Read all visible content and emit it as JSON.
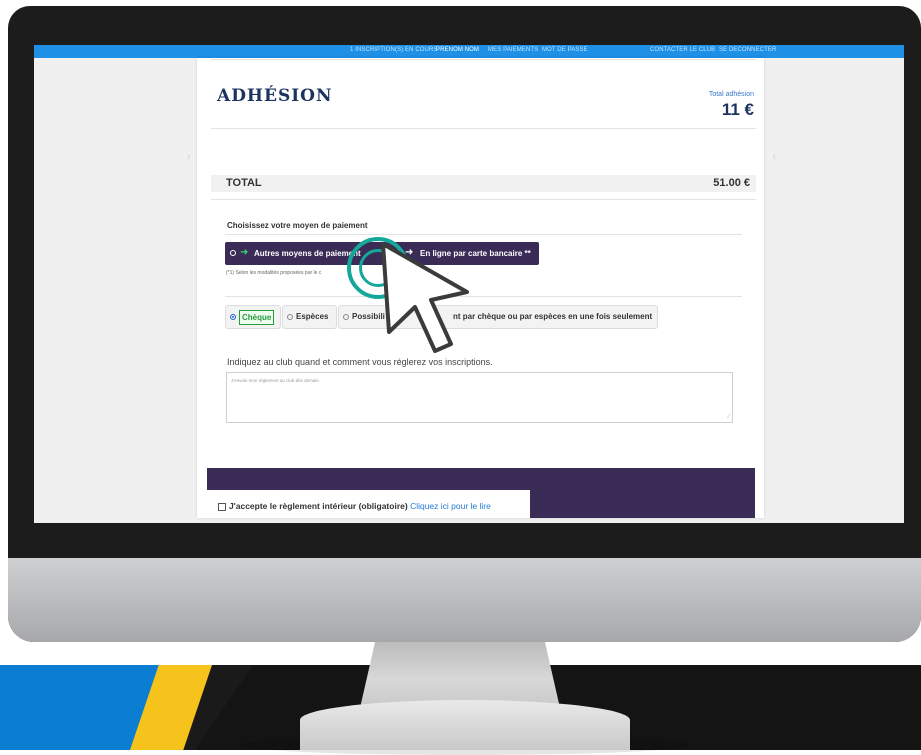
{
  "topbar": {
    "items": [
      "1 INSCRIPTION(S) EN COURS",
      "PRENOM NOM",
      "MES PAIEMENTS",
      "MOT DE PASSE",
      "CONTACTER LE CLUB",
      "SE DECONNECTER"
    ]
  },
  "header": {
    "title": "ADHÉSION",
    "total_label": "Total adhésion",
    "total_value": "11 €"
  },
  "total": {
    "label": "TOTAL",
    "value": "51.00 €"
  },
  "payment": {
    "prompt": "Choisissez votre moyen de paiement",
    "options": [
      "Autres moyens de paiement",
      "En ligne par carte bancaire **"
    ],
    "footnote": "(*1) Selon les modalités proposées par le c",
    "methods": [
      "Chèque",
      "Espèces",
      "Possibili",
      "nt par chèque ou par espèces en une fois seulement"
    ],
    "selected_method": "Chèque"
  },
  "comment": {
    "label": "Indiquez au club quand et comment vous réglerez vos inscriptions.",
    "value": "J'envoie mon règlement au club dès demain"
  },
  "acceptance": {
    "label": "J'accepte le règlement intérieur (obligatoire)",
    "link": "Cliquez ici pour le lire"
  },
  "colors": {
    "topbar": "#1e90e6",
    "navy": "#1d3461",
    "purple": "#3b2b57",
    "green": "#2b9a3c",
    "teal_click": "#14a89a",
    "blue_stripe": "#0b7ed1",
    "yellow_stripe": "#f6c21c"
  },
  "icons": [
    "radio-icon",
    "arrow-right-icon",
    "checkbox-icon",
    "cursor-pointer-icon",
    "click-ripple-icon"
  ]
}
